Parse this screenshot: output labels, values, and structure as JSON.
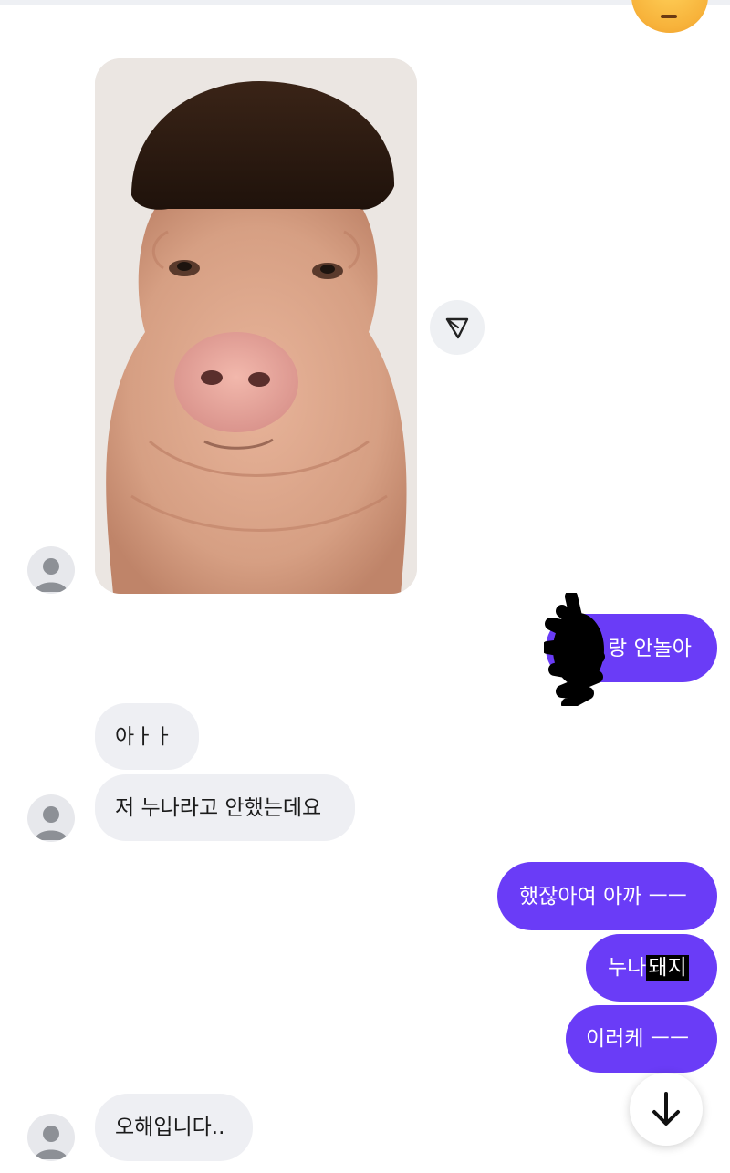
{
  "chat": {
    "messages": [
      {
        "id": "m1",
        "from": "other",
        "type": "image",
        "image_desc": "pig-with-bowl-haircut"
      },
      {
        "id": "m2",
        "from": "me",
        "text": "랑 안놀아",
        "redacted_prefix": true
      },
      {
        "id": "m3",
        "from": "other",
        "text": "아ㅏㅏ"
      },
      {
        "id": "m4",
        "from": "other",
        "text": "저 누나라고 안했는데요"
      },
      {
        "id": "m5",
        "from": "me",
        "text": "했잖아여 아까 ㅡㅡ"
      },
      {
        "id": "m6",
        "from": "me",
        "text_plain": "누나 ",
        "text_highlight": "돼지"
      },
      {
        "id": "m7",
        "from": "me",
        "text": "이러케 ㅡㅡ"
      },
      {
        "id": "m8",
        "from": "other",
        "text": "오해입니다.."
      }
    ]
  },
  "icons": {
    "avatar": "default-person-icon",
    "share": "send-triangle-icon",
    "scroll_down": "arrow-down-icon",
    "emoji": "expressionless-face-emoji"
  },
  "colors": {
    "outgoing_bubble": "#6a3cf7",
    "incoming_bubble": "#eeeff3",
    "background": "#ffffff"
  }
}
